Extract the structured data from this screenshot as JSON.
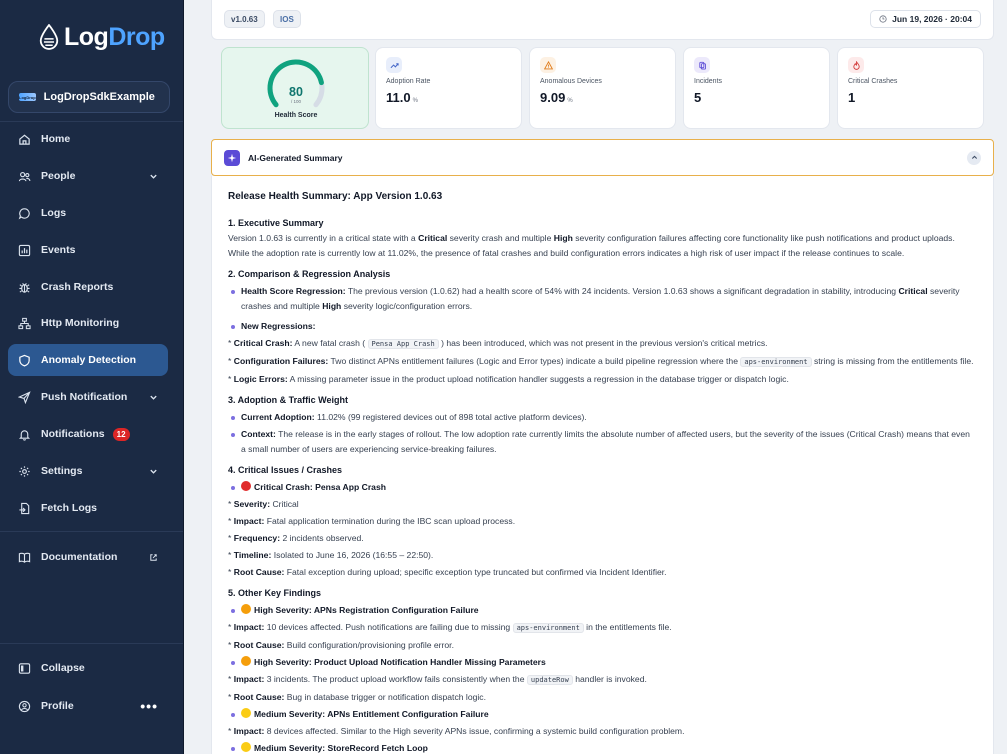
{
  "brand": {
    "name_a": "Log",
    "name_b": "Drop"
  },
  "app_selector": {
    "logo_text": "LogDrop",
    "name": "LogDropSdkExample"
  },
  "nav": {
    "home": "Home",
    "people": "People",
    "logs": "Logs",
    "events": "Events",
    "crash_reports": "Crash Reports",
    "http_monitoring": "Http Monitoring",
    "anomaly_detection": "Anomaly Detection",
    "push_notification": "Push Notification",
    "notifications": "Notifications",
    "notifications_count": "12",
    "settings": "Settings",
    "fetch_logs": "Fetch Logs",
    "documentation": "Documentation",
    "collapse": "Collapse",
    "profile": "Profile",
    "profile_more": "•••"
  },
  "topbar": {
    "version": "v1.0.63",
    "platform": "IOS",
    "datetime": "Jun 19, 2026 · 20:04"
  },
  "health": {
    "score": 80,
    "of": "/ 100",
    "label": "Health Score"
  },
  "metrics": {
    "adoption": {
      "label": "Adoption Rate",
      "value": "11.0",
      "unit": "%"
    },
    "anomalous": {
      "label": "Anomalous Devices",
      "value": "9.09",
      "unit": "%"
    },
    "incidents": {
      "label": "Incidents",
      "value": "5"
    },
    "critical": {
      "label": "Critical Crashes",
      "value": "1"
    }
  },
  "summary": {
    "header": "AI-Generated Summary",
    "title": "Release Health Summary: App Version 1.0.63",
    "s1": "1. Executive Summary",
    "s1_p_a": "Version 1.0.63 is currently in a critical state with a ",
    "s1_p_b": "Critical",
    "s1_p_c": " severity crash and multiple ",
    "s1_p_d": "High",
    "s1_p_e": " severity configuration failures affecting core functionality like push notifications and product uploads. While the adoption rate is currently low at 11.02%, the presence of fatal crashes and build configuration errors indicates a high risk of user impact if the release continues to scale.",
    "s2": "2. Comparison & Regression Analysis",
    "s2_b1_k": "Health Score Regression:",
    "s2_b1_a": " The previous version (1.0.62) had a health score of 54% with 24 incidents. Version 1.0.63 shows a significant degradation in stability, introducing ",
    "s2_b1_b": "Critical",
    "s2_b1_c": " severity crashes and multiple ",
    "s2_b1_d": "High",
    "s2_b1_e": " severity logic/configuration errors.",
    "s2_b2_k": "New Regressions:",
    "s2_l1_k": "Critical Crash:",
    "s2_l1_a": " A new fatal crash ( ",
    "s2_l1_code": "Pensa App Crash",
    "s2_l1_b": " ) has been introduced, which was not present in the previous version's critical metrics.",
    "s2_l2_k": "Configuration Failures:",
    "s2_l2_a": " Two distinct APNs entitlement failures (Logic and Error types) indicate a build pipeline regression where the ",
    "s2_l2_code": "aps-environment",
    "s2_l2_b": " string is missing from the entitlements file.",
    "s2_l3_k": "Logic Errors:",
    "s2_l3_a": " A missing parameter issue in the product upload notification handler suggests a regression in the database trigger or dispatch logic.",
    "s3": "3. Adoption & Traffic Weight",
    "s3_b1_k": "Current Adoption:",
    "s3_b1_a": " 11.02% (99 registered devices out of 898 total active platform devices).",
    "s3_b2_k": "Context:",
    "s3_b2_a": " The release is in the early stages of rollout. The low adoption rate currently limits the absolute number of affected users, but the severity of the issues (Critical Crash) means that even a small number of users are experiencing service-breaking failures.",
    "s4": "4. Critical Issues / Crashes",
    "s4_b1": "Critical Crash: Pensa App Crash",
    "s4_sev_k": "Severity:",
    "s4_sev_v": " Critical",
    "s4_imp_k": "Impact:",
    "s4_imp_v": " Fatal application termination during the IBC scan upload process.",
    "s4_freq_k": "Frequency:",
    "s4_freq_v": " 2 incidents observed.",
    "s4_time_k": "Timeline:",
    "s4_time_v": " Isolated to June 16, 2026 (16:55 – 22:50).",
    "s4_rc_k": "Root Cause:",
    "s4_rc_v": " Fatal exception during upload; specific exception type truncated but confirmed via Incident Identifier.",
    "s5": "5. Other Key Findings",
    "f1_t": "High Severity: APNs Registration Configuration Failure",
    "f1_imp_k": "Impact:",
    "f1_imp_a": " 10 devices affected. Push notifications are failing due to missing ",
    "f1_imp_code": "aps-environment",
    "f1_imp_b": " in the entitlements file.",
    "f1_rc_k": "Root Cause:",
    "f1_rc_v": " Build configuration/provisioning profile error.",
    "f2_t": "High Severity: Product Upload Notification Handler Missing Parameters",
    "f2_imp_k": "Impact:",
    "f2_imp_a": " 3 incidents. The product upload workflow fails consistently when the ",
    "f2_imp_code": "updateRow",
    "f2_imp_b": " handler is invoked.",
    "f2_rc_k": "Root Cause:",
    "f2_rc_v": " Bug in database trigger or notification dispatch logic.",
    "f3_t": "Medium Severity: APNs Entitlement Configuration Failure",
    "f3_imp_k": "Impact:",
    "f3_imp_v": " 8 devices affected. Similar to the High severity APNs issue, confirming a systemic build configuration problem.",
    "f4_t": "Medium Severity: StoreRecord Fetch Loop",
    "star": "*"
  },
  "colors": {
    "sidebar": "#1b2a44",
    "active": "#2c5891",
    "accent": "#4ea3ff",
    "health_bg": "#e6f6ee",
    "summary_border": "#e8b04b"
  }
}
